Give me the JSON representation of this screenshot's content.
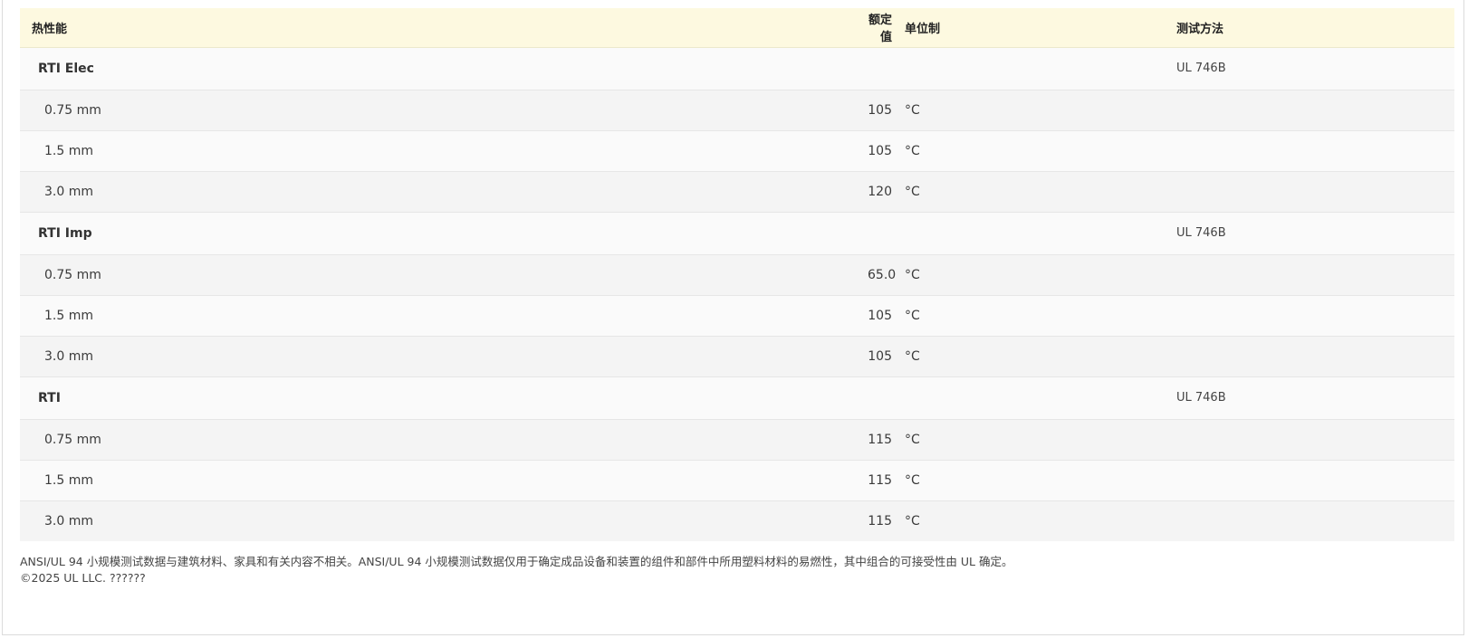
{
  "table": {
    "headers": {
      "property": "热性能",
      "value": "额定值",
      "unit": "单位制",
      "method": "测试方法"
    },
    "groups": [
      {
        "name": "RTI Elec",
        "method": "UL 746B",
        "rows": [
          {
            "thickness": "0.75 mm",
            "value": "105",
            "unit": "°C"
          },
          {
            "thickness": "1.5 mm",
            "value": "105",
            "unit": "°C"
          },
          {
            "thickness": "3.0 mm",
            "value": "120",
            "unit": "°C"
          }
        ]
      },
      {
        "name": "RTI Imp",
        "method": "UL 746B",
        "rows": [
          {
            "thickness": "0.75 mm",
            "value": "65.0",
            "unit": "°C"
          },
          {
            "thickness": "1.5 mm",
            "value": "105",
            "unit": "°C"
          },
          {
            "thickness": "3.0 mm",
            "value": "105",
            "unit": "°C"
          }
        ]
      },
      {
        "name": "RTI",
        "method": "UL 746B",
        "rows": [
          {
            "thickness": "0.75 mm",
            "value": "115",
            "unit": "°C"
          },
          {
            "thickness": "1.5 mm",
            "value": "115",
            "unit": "°C"
          },
          {
            "thickness": "3.0 mm",
            "value": "115",
            "unit": "°C"
          }
        ]
      }
    ]
  },
  "footer": {
    "disclaimer": "ANSI/UL 94 小规模测试数据与建筑材料、家具和有关内容不相关。ANSI/UL 94 小规模测试数据仅用于确定成品设备和装置的组件和部件中所用塑料材料的易燃性，其中组合的可接受性由 UL 确定。",
    "copyright": "©2025 UL LLC. ??????"
  }
}
